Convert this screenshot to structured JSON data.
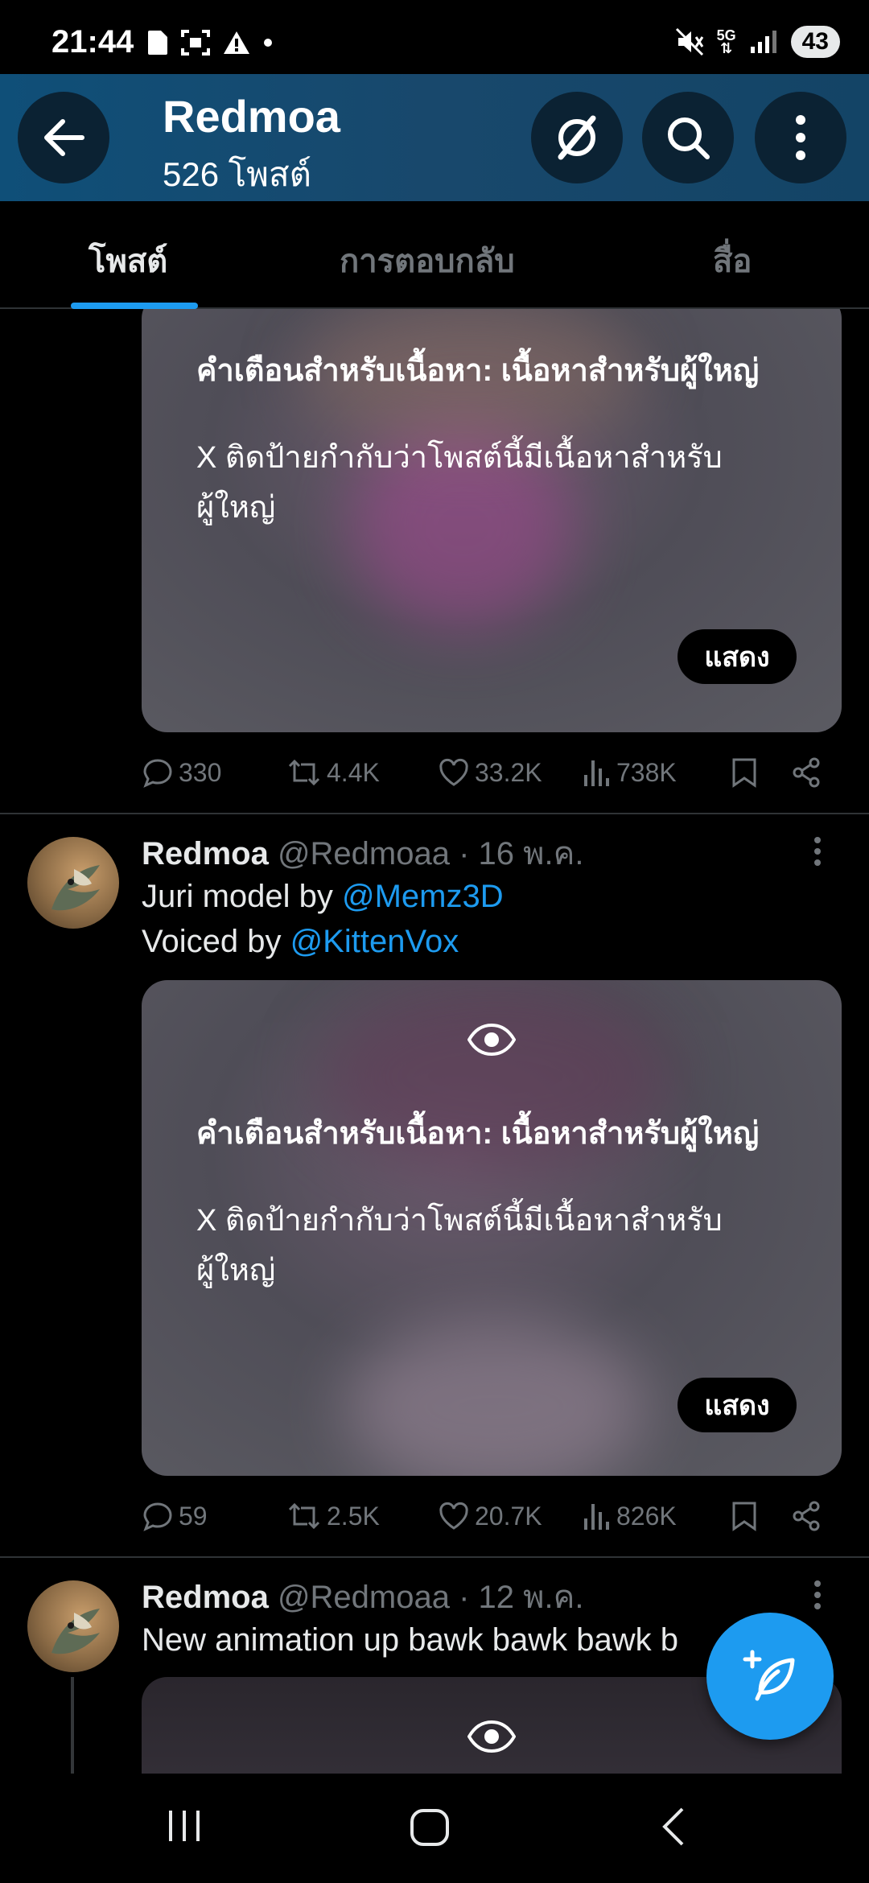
{
  "status": {
    "time": "21:44",
    "battery": "43",
    "network": "5G"
  },
  "header": {
    "title": "Redmoa",
    "subtitle": "526 โพสต์"
  },
  "tabs": [
    {
      "label": "โพสต์",
      "active": true
    },
    {
      "label": "การตอบกลับ",
      "active": false
    },
    {
      "label": "สื่อ",
      "active": false
    }
  ],
  "warning": {
    "title": "คำเตือนสำหรับเนื้อหา: เนื้อหาสำหรับผู้ใหญ่",
    "text": "X ติดป้ายกำกับว่าโพสต์นี้มีเนื้อหาสำหรับผู้ใหญ่",
    "show_label": "แสดง"
  },
  "posts": [
    {
      "stats": {
        "replies": "330",
        "reposts": "4.4K",
        "likes": "33.2K",
        "views": "738K"
      }
    },
    {
      "name": "Redmoa",
      "handle": "@Redmoaa",
      "date": "· 16 พ.ค.",
      "line1_text": "Juri model by ",
      "line1_mention": "@Memz3D",
      "line2_text": "Voiced by ",
      "line2_mention": "@KittenVox",
      "stats": {
        "replies": "59",
        "reposts": "2.5K",
        "likes": "20.7K",
        "views": "826K"
      }
    },
    {
      "name": "Redmoa",
      "handle": "@Redmoaa",
      "date": "· 12 พ.ค.",
      "text": "New animation up bawk bawk bawk b"
    }
  ],
  "icons": {
    "accent": "#1d9bf0",
    "header_bg": "#134466"
  }
}
